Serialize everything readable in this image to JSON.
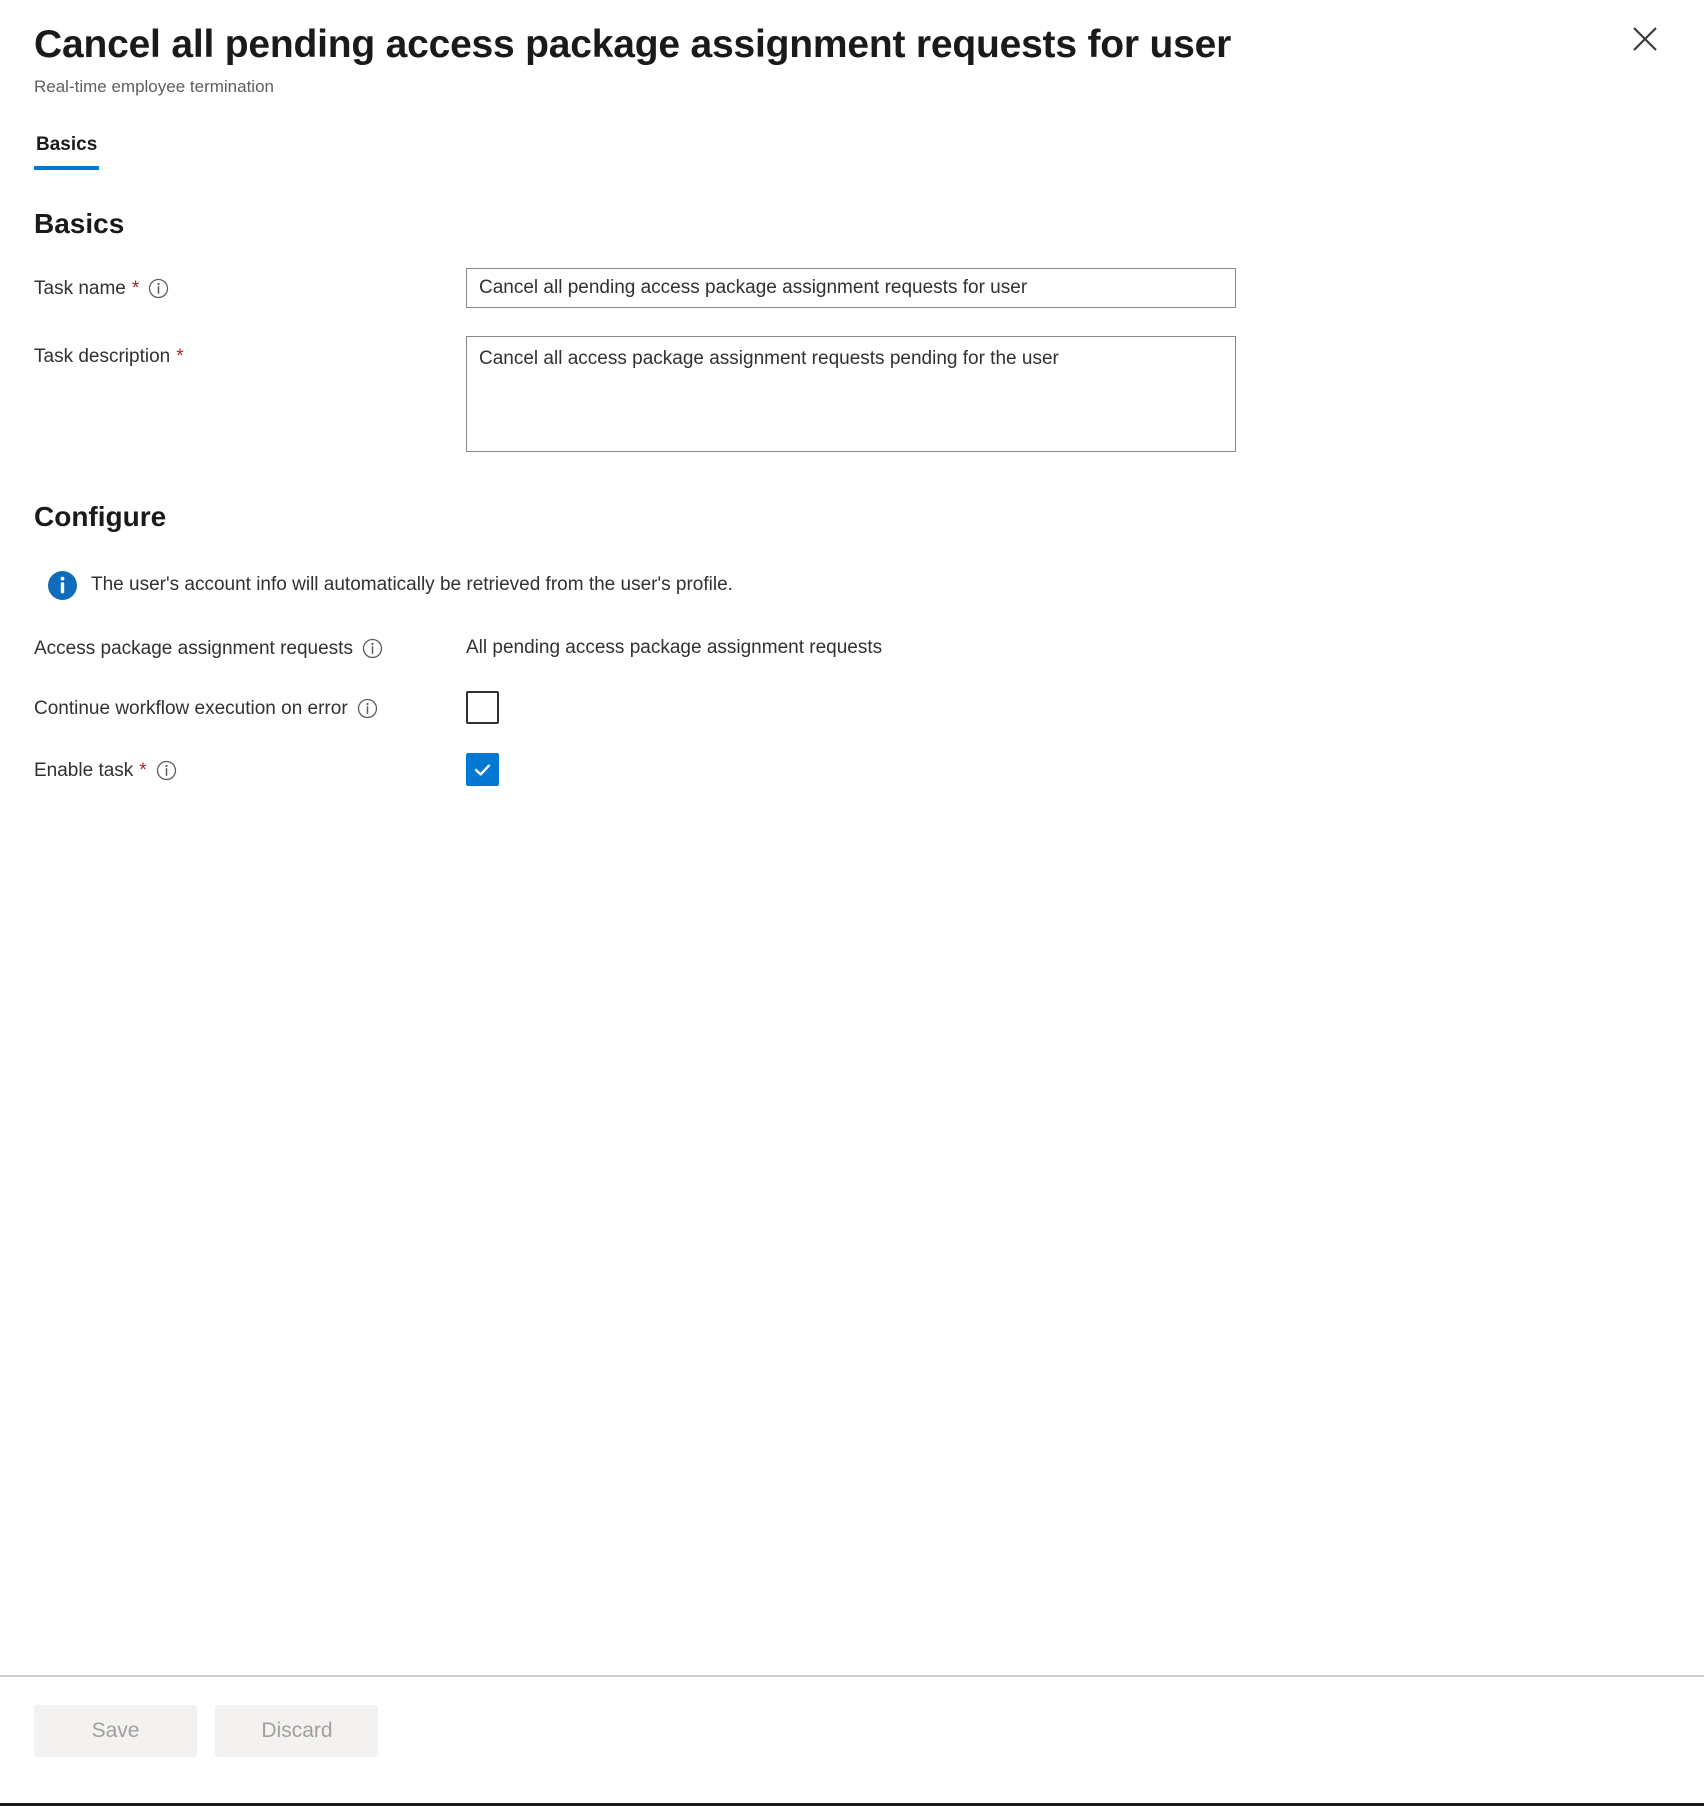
{
  "header": {
    "title": "Cancel all pending access package assignment requests for user",
    "subtitle": "Real-time employee termination",
    "close_icon": "close-icon"
  },
  "tabs": [
    {
      "label": "Basics",
      "active": true
    }
  ],
  "sections": {
    "basics": {
      "heading": "Basics",
      "task_name": {
        "label": "Task name",
        "required_marker": "*",
        "info_icon": "info-circle-icon",
        "value": "Cancel all pending access package assignment requests for user",
        "placeholder": "Task name"
      },
      "task_description": {
        "label": "Task description",
        "required_marker": "*",
        "value": "Cancel all access package assignment requests pending for the user",
        "placeholder": "Task description"
      }
    },
    "configure": {
      "heading": "Configure",
      "info_message": {
        "icon": "info-filled-icon",
        "text": "The user's account info will automatically be retrieved from the user's profile."
      },
      "access_package_requests": {
        "label": "Access package assignment requests",
        "info_icon": "info-circle-icon",
        "value": "All pending access package assignment requests"
      },
      "continue_on_error": {
        "label": "Continue workflow execution on error",
        "info_icon": "info-circle-icon",
        "checked": false
      },
      "enable_task": {
        "label": "Enable task",
        "required_marker": "*",
        "info_icon": "info-circle-icon",
        "checked": true
      }
    }
  },
  "footer": {
    "save_label": "Save",
    "discard_label": "Discard"
  },
  "colors": {
    "accent": "#0078d4",
    "required": "#a4262c",
    "text": "#323130",
    "subtle_text": "#605e5c",
    "border": "#8a8886",
    "disabled_bg": "#f3f2f1",
    "disabled_text": "#a19f9d"
  }
}
